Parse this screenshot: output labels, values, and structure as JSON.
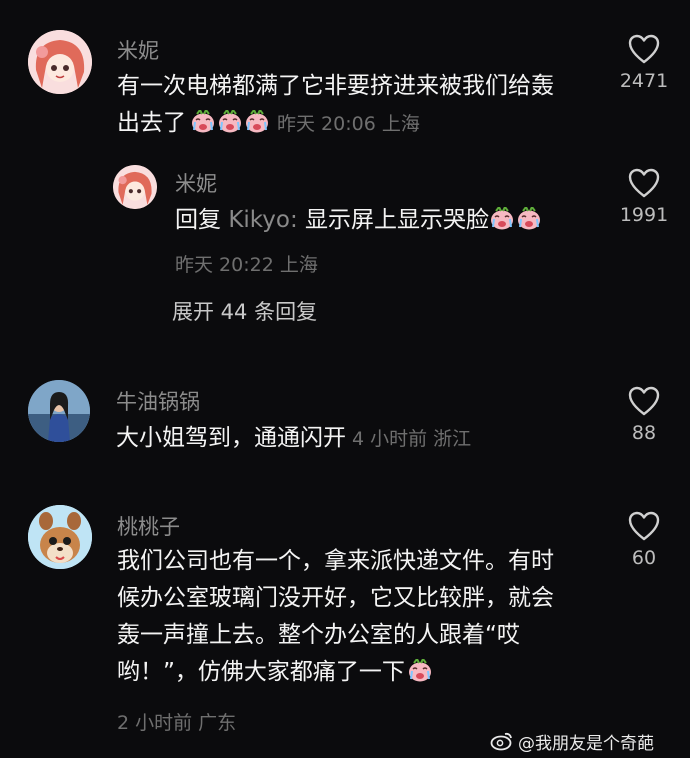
{
  "comments": [
    {
      "username": "米妮",
      "text_line1": "有一次电梯都满了它非要挤进来被我们给轰",
      "text_line2": "出去了",
      "meta": "昨天 20:06 上海",
      "likes": "2471",
      "avatar_icon": "anime-girl-avatar",
      "reply": {
        "username": "米妮",
        "prefix": "回复 ",
        "mention": "Kikyo:",
        "text": " 显示屏上显示哭脸",
        "meta": "昨天 20:22 上海",
        "likes": "1991"
      },
      "expand_label": "展开 44 条回复"
    },
    {
      "username": "牛油锅锅",
      "text": "大小姐驾到，通通闪开",
      "meta": "4 小时前 浙江",
      "likes": "88",
      "avatar_icon": "photo-avatar"
    },
    {
      "username": "桃桃子",
      "text_lines": [
        "我们公司也有一个，拿来派快递文件。有时",
        "候办公室玻璃门没开好，它又比较胖，就会",
        "轰一声撞上去。整个办公室的人跟着“哎",
        "哟！”，仿佛大家都痛了一下"
      ],
      "meta": "2 小时前 广东",
      "likes": "60",
      "avatar_icon": "chipmunk-avatar"
    }
  ],
  "watermark": "@我朋友是个奇葩",
  "colors": {
    "background": "#0b0b0d",
    "meta": "#6f6f6f",
    "username": "#8c8c8c"
  }
}
